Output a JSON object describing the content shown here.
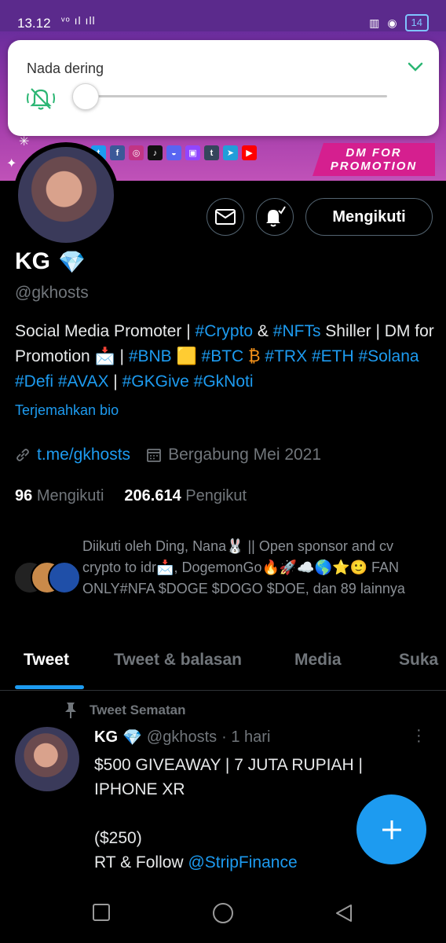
{
  "status_bar": {
    "time": "13.12",
    "signal": "ᵛᵒ ıl ıll",
    "battery": "14"
  },
  "ringer": {
    "title": "Nada dering",
    "level": 0
  },
  "banner": {
    "promo_line1": "DM FOR",
    "promo_line2": "PROMOTION",
    "social_icons": [
      "twitter-icon",
      "facebook-icon",
      "instagram-icon",
      "tiktok-icon",
      "discord-icon",
      "twitch-icon",
      "tumblr-icon",
      "telegram-icon",
      "youtube-icon"
    ]
  },
  "profile": {
    "follow_label": "Mengikuti",
    "name": "KG",
    "name_emoji": "💎",
    "handle": "@gkhosts",
    "bio": {
      "p1": "Social Media Promoter | ",
      "t1": "#Crypto",
      "p2": " & ",
      "t2": "#NFTs",
      "p3": " Shiller | DM for Promotion 📩 | ",
      "t3": "#BNB",
      "e1": " 🟨 ",
      "t4": "#BTC",
      "e2": " ₿  ",
      "t5": "#TRX",
      "p4": " ",
      "t6": "#ETH",
      "p5": " ",
      "t7": "#Solana",
      "p6": " ",
      "t8": "#Defi",
      "p7": " ",
      "t9": "#AVAX",
      "p8": " | ",
      "t10": "#GKGive",
      "p9": " ",
      "t11": "#GkNoti"
    },
    "translate_label": "Terjemahkan bio",
    "link": "t.me/gkhosts",
    "joined": "Bergabung Mei 2021",
    "following_count": "96",
    "following_label": "Mengikuti",
    "followers_count": "206.614",
    "followers_label": "Pengikut",
    "followed_by": "Diikuti oleh Ding, Nana🐰 || Open sponsor and cv crypto to idr📩, DogemonGo🔥🚀☁️🌎⭐🙂 FAN ONLY#NFA $DOGE $DOGO $DOE, dan 89 lainnya"
  },
  "tabs": [
    "Tweet",
    "Tweet & balasan",
    "Media",
    "Suka"
  ],
  "pinned": {
    "label": "Tweet Sematan",
    "name": "KG",
    "name_emoji": "💎",
    "handle": "@gkhosts",
    "time": "· 1 hari",
    "body_main": "$500 GIVEAWAY | 7 JUTA RUPIAH | IPHONE XR\n\n($250)\nRT & Follow ",
    "mention": "@StripFinance"
  },
  "colors": {
    "accent": "#1d9bf0",
    "background": "#000000",
    "promo_pink": "#d51f8f"
  }
}
